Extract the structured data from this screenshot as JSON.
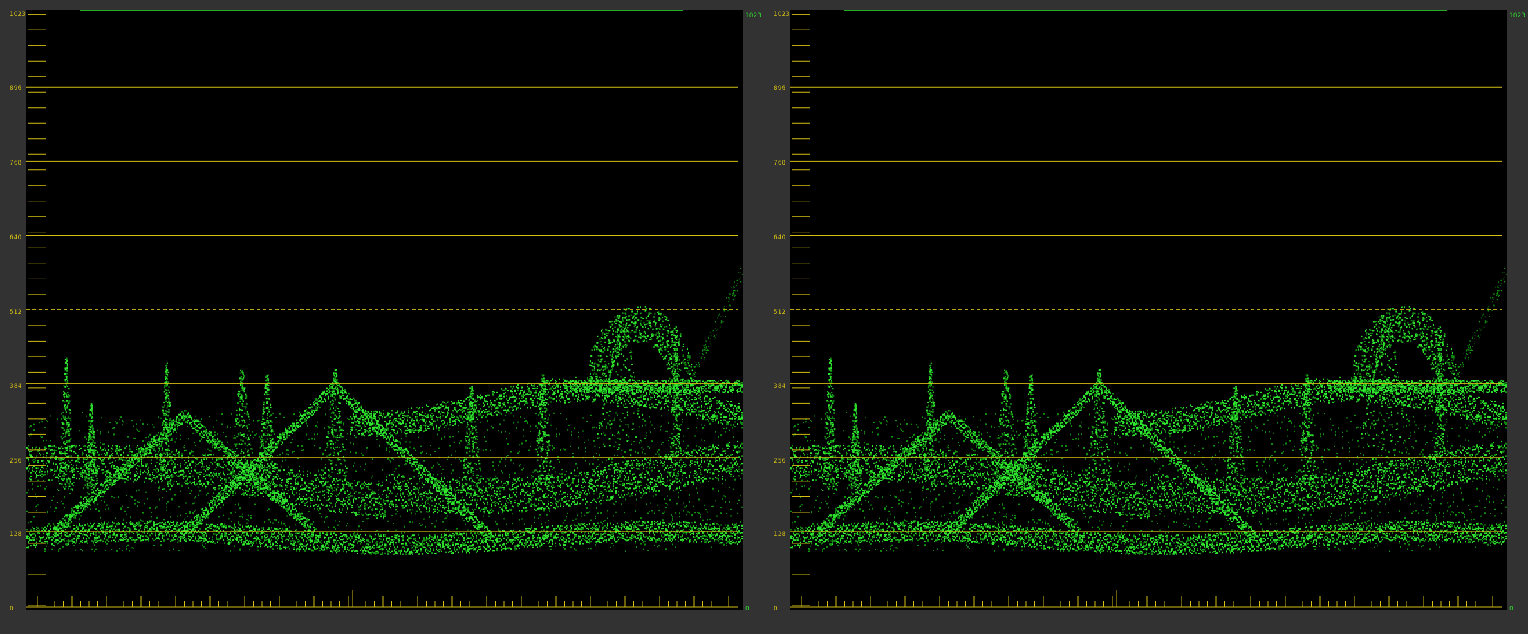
{
  "scopes": [
    {
      "name": "waveform-left",
      "y_labels": [
        "1023",
        "896",
        "768",
        "640",
        "512",
        "384",
        "256",
        "128",
        "0"
      ],
      "right_top_label": "1023",
      "right_bottom_label": "0"
    },
    {
      "name": "waveform-right",
      "y_labels": [
        "1023",
        "896",
        "768",
        "640",
        "512",
        "384",
        "256",
        "128",
        "0"
      ],
      "right_top_label": "1023",
      "right_bottom_label": "0"
    }
  ],
  "colors": {
    "background": "#323232",
    "scope_bg": "#000000",
    "graticule": "#d4bf12",
    "trace": "#2fe52f",
    "trace_dim": "#108f10"
  }
}
